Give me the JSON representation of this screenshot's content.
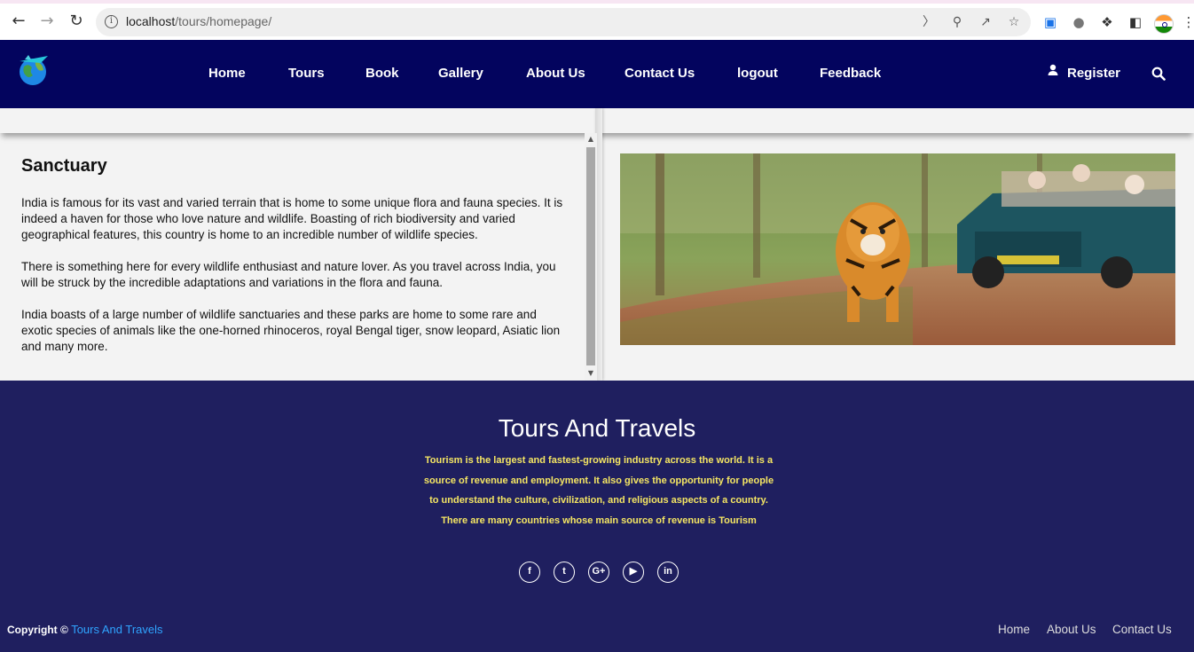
{
  "browser": {
    "url_host": "localhost",
    "url_path": "/tours/homepage/"
  },
  "nav": {
    "items": [
      "Home",
      "Tours",
      "Book",
      "Gallery",
      "About Us",
      "Contact Us",
      "logout",
      "Feedback"
    ],
    "register_label": "Register"
  },
  "article": {
    "title": "Sanctuary",
    "paragraphs": [
      "India is famous for its vast and varied terrain that is home to some unique flora and fauna species. It is indeed a haven for those who love nature and wildlife. Boasting of rich biodiversity and varied geographical features, this country is home to an incredible number of wildlife species.",
      "There is something here for every wildlife enthusiast and nature lover. As you travel across India, you will be struck by the incredible adaptations and variations in the flora and fauna.",
      "India boasts of a large number of wildlife sanctuaries and these parks are home to some rare and exotic species of animals like the one-horned rhinoceros, royal Bengal tiger, snow leopard, Asiatic lion and many more."
    ]
  },
  "footer": {
    "title": "Tours And Travels",
    "description": "Tourism is the largest and fastest-growing industry across the world. It is a source of revenue and employment. It also gives the opportunity for people to understand the culture, civilization, and religious aspects of a country. There are many countries whose main source of revenue is Tourism",
    "socials": [
      "facebook-icon",
      "twitter-icon",
      "google-plus-icon",
      "youtube-icon",
      "linkedin-icon"
    ],
    "social_glyphs": [
      "f",
      "t",
      "G+",
      "▶",
      "in"
    ],
    "copyright_prefix": "Copyright ©",
    "copyright_brand": "Tours And Travels",
    "links": [
      "Home",
      "About Us",
      "Contact Us"
    ]
  },
  "colors": {
    "header_bg": "#03045e",
    "footer_bg": "#1f1f5f",
    "footer_desc": "#f5e663",
    "brand_link": "#2fa4ff"
  }
}
